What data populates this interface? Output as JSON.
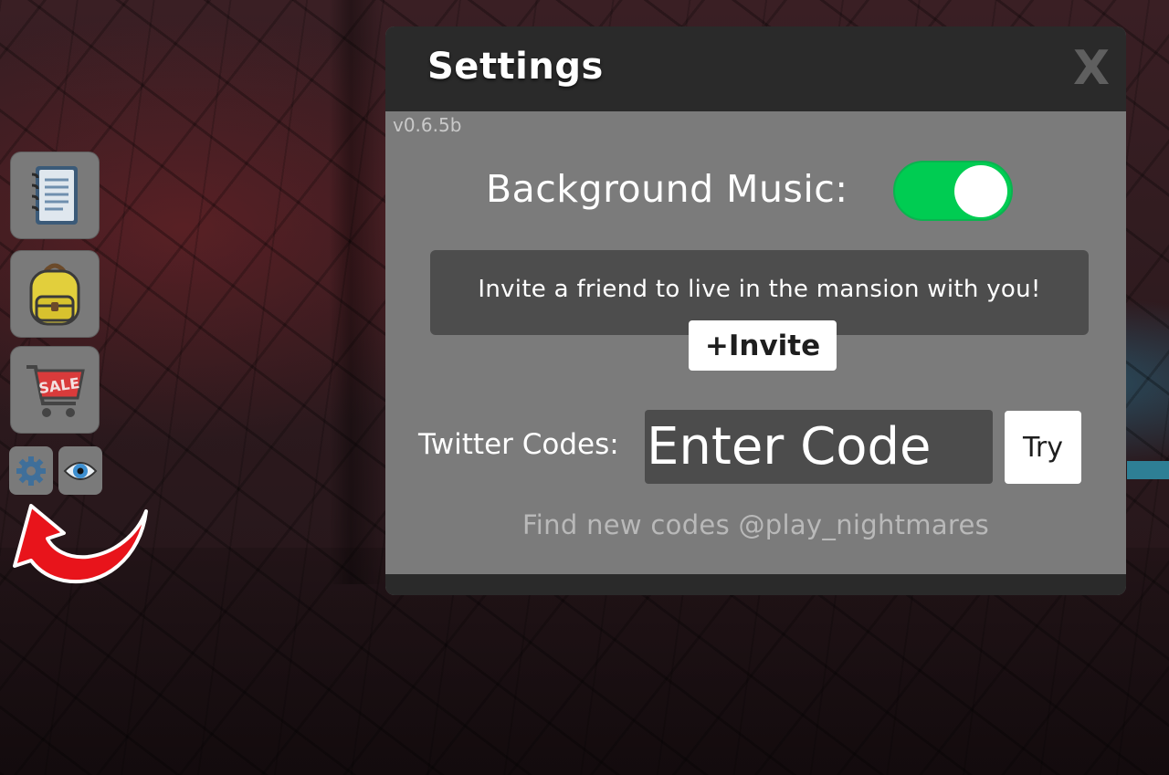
{
  "settings_panel": {
    "title": "Settings",
    "close_label": "X",
    "version": "v0.6.5b",
    "background_music_label": "Background Music:",
    "background_music_on": true,
    "invite_text": "Invite a friend to live in the mansion with you!",
    "invite_button": "+Invite",
    "twitter_codes_label": "Twitter Codes:",
    "code_placeholder": "Enter Code",
    "try_button": "Try",
    "find_codes_text": "Find new codes @play_nightmares"
  },
  "sidebar": {
    "buttons": [
      {
        "icon": "notebook-icon"
      },
      {
        "icon": "backpack-icon"
      },
      {
        "icon": "sale-cart-icon",
        "label": "SALE"
      }
    ],
    "small_buttons": [
      {
        "icon": "gear-icon"
      },
      {
        "icon": "eye-icon"
      }
    ]
  },
  "colors": {
    "toggle_on": "#00cc52",
    "panel_bg": "#7b7b7b",
    "panel_header": "#2a2a2a",
    "arrow": "#e8141b"
  }
}
